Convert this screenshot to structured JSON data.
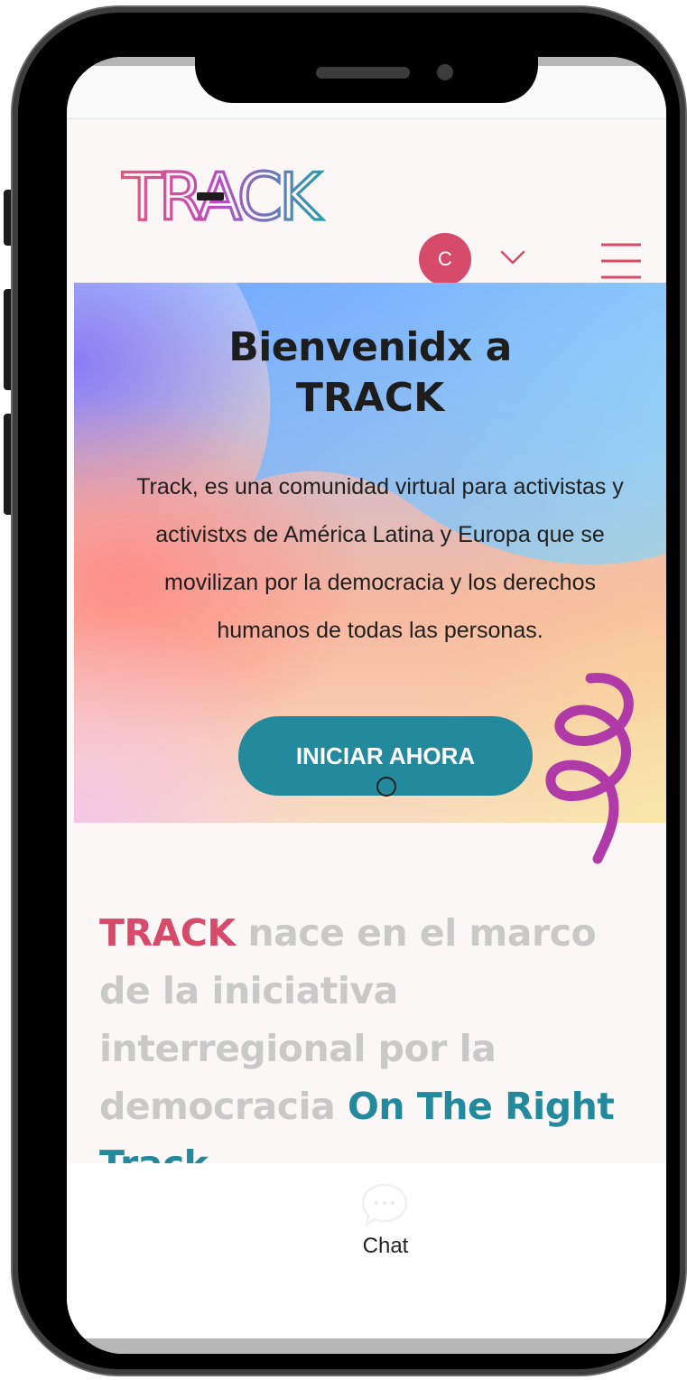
{
  "header": {
    "logo_text": "TRACK",
    "avatar_initial": "C"
  },
  "hero": {
    "title_line1": "Bienvenidx a",
    "title_line2": "TRACK",
    "description": "Track, es una comunidad virtual para activistas y activistxs de América Latina y Europa que se movilizan por la democracia y los derechos humanos de todas las personas.",
    "cta_label": "INICIAR AHORA"
  },
  "intro": {
    "brand": "TRACK",
    "middle": " nace en el marco de la iniciativa interregional por la democracia ",
    "highlight": "On The Right Track"
  },
  "chat": {
    "label": "Chat"
  },
  "colors": {
    "brand_pink": "#d64a6a",
    "brand_teal": "#23899c",
    "squiggle_purple": "#b03aa8"
  },
  "icons": [
    "chevron-down-icon",
    "hamburger-menu-icon",
    "chat-bubble-icon"
  ]
}
